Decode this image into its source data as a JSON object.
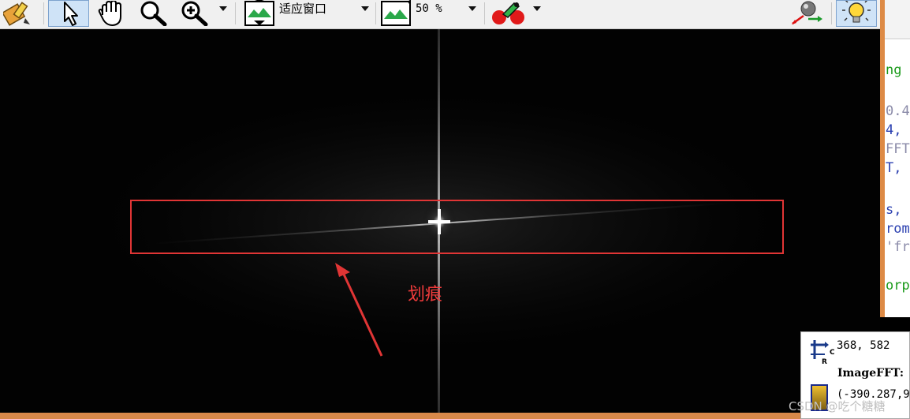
{
  "toolbar": {
    "zoom_fit_label": "适应窗口",
    "zoom_percent_label": "50 %"
  },
  "annotation": {
    "label": "划痕"
  },
  "code_panel": {
    "lines": [
      {
        "text": "ng",
        "color": "#1a9a1a"
      },
      {
        "text": "0.4",
        "color": "#8a8aa8"
      },
      {
        "text": "4,",
        "color": "#2a3fb0"
      },
      {
        "text": "FFT",
        "color": "#8a8aa8"
      },
      {
        "text": "T,",
        "color": "#2a3fb0"
      },
      {
        "text": "s,",
        "color": "#2a3fb0"
      },
      {
        "text": "rom",
        "color": "#2a3fb0"
      },
      {
        "text": "'fr",
        "color": "#8a8aa8"
      },
      {
        "text": "orp",
        "color": "#1a9a1a"
      }
    ]
  },
  "info_panel": {
    "coordinates": "368, 582",
    "image_name": "ImageFFT:",
    "value": "(-390.287,9"
  },
  "watermark": "CSDN @吃个糖糖",
  "colors": {
    "annotation": "#e03535",
    "panel_border": "#dd8a45"
  }
}
